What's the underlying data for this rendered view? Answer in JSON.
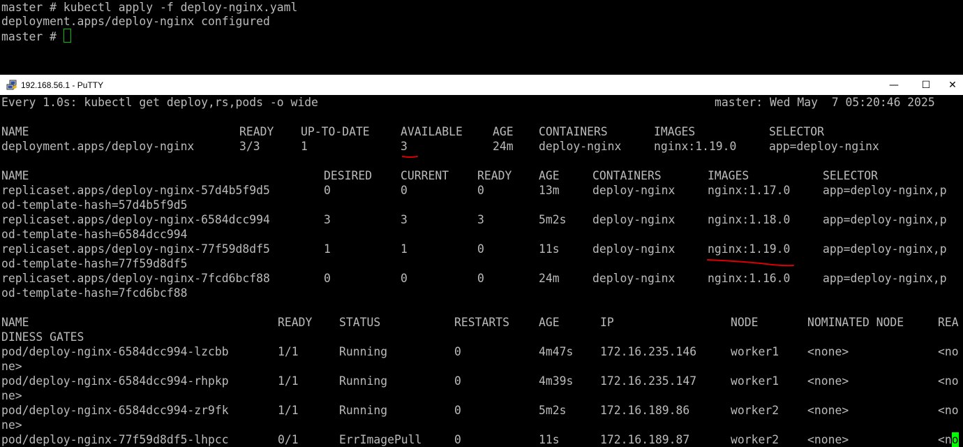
{
  "top_terminal": {
    "lines": [
      "master # kubectl apply -f deploy-nginx.yaml",
      "deployment.apps/deploy-nginx configured",
      "master # "
    ]
  },
  "window": {
    "title": "192.168.56.1 - PuTTY",
    "minimize_glyph": "—",
    "maximize_glyph": "☐",
    "close_glyph": "✕",
    "icon": "putty-computers-icon"
  },
  "watch": {
    "command": "Every 1.0s: kubectl get deploy,rs,pods -o wide",
    "host_time": "master: Wed May  7 05:20:46 2025"
  },
  "deploy_table": {
    "headers": [
      "NAME",
      "READY",
      "UP-TO-DATE",
      "AVAILABLE",
      "AGE",
      "CONTAINERS",
      "IMAGES",
      "SELECTOR"
    ],
    "rows": [
      [
        "deployment.apps/deploy-nginx",
        "3/3",
        "1",
        "3",
        "24m",
        "deploy-nginx",
        "nginx:1.19.0",
        "app=deploy-nginx"
      ]
    ]
  },
  "rs_table": {
    "headers": [
      "NAME",
      "DESIRED",
      "CURRENT",
      "READY",
      "AGE",
      "CONTAINERS",
      "IMAGES",
      "SELECTOR"
    ],
    "rows": [
      {
        "cells": [
          "replicaset.apps/deploy-nginx-57d4b5f9d5",
          "0",
          "0",
          "0",
          "13m",
          "deploy-nginx",
          "nginx:1.17.0",
          "app=deploy-nginx,p"
        ],
        "wrap": "od-template-hash=57d4b5f9d5"
      },
      {
        "cells": [
          "replicaset.apps/deploy-nginx-6584dcc994",
          "3",
          "3",
          "3",
          "5m2s",
          "deploy-nginx",
          "nginx:1.18.0",
          "app=deploy-nginx,p"
        ],
        "wrap": "od-template-hash=6584dcc994"
      },
      {
        "cells": [
          "replicaset.apps/deploy-nginx-77f59d8df5",
          "1",
          "1",
          "0",
          "11s",
          "deploy-nginx",
          "nginx:1.19.0",
          "app=deploy-nginx,p"
        ],
        "wrap": "od-template-hash=77f59d8df5"
      },
      {
        "cells": [
          "replicaset.apps/deploy-nginx-7fcd6bcf88",
          "0",
          "0",
          "0",
          "24m",
          "deploy-nginx",
          "nginx:1.16.0",
          "app=deploy-nginx,p"
        ],
        "wrap": "od-template-hash=7fcd6bcf88"
      }
    ]
  },
  "pod_table": {
    "headers": [
      "NAME",
      "READY",
      "STATUS",
      "RESTARTS",
      "AGE",
      "IP",
      "NODE",
      "NOMINATED NODE",
      "REA"
    ],
    "header_wrap": "DINESS GATES",
    "rows": [
      {
        "cells": [
          "pod/deploy-nginx-6584dcc994-lzcbb",
          "1/1",
          "Running",
          "0",
          "4m47s",
          "172.16.235.146",
          "worker1",
          "<none>",
          "<no"
        ],
        "wrap": "ne>"
      },
      {
        "cells": [
          "pod/deploy-nginx-6584dcc994-rhpkp",
          "1/1",
          "Running",
          "0",
          "4m39s",
          "172.16.235.147",
          "worker1",
          "<none>",
          "<no"
        ],
        "wrap": "ne>"
      },
      {
        "cells": [
          "pod/deploy-nginx-6584dcc994-zr9fk",
          "1/1",
          "Running",
          "0",
          "5m2s",
          "172.16.189.86",
          "worker2",
          "<none>",
          "<no"
        ],
        "wrap": "ne>"
      },
      {
        "cells": [
          "pod/deploy-nginx-77f59d8df5-lhpcc",
          "0/1",
          "ErrImagePull",
          "0",
          "11s",
          "172.16.189.87",
          "worker2",
          "<none>",
          "<n"
        ],
        "cursor_char": "o"
      }
    ]
  },
  "colors": {
    "terminal_bg": "#000000",
    "terminal_fg": "#bbbbbb",
    "cursor": "#00ff00",
    "annotation": "#dd0000"
  }
}
